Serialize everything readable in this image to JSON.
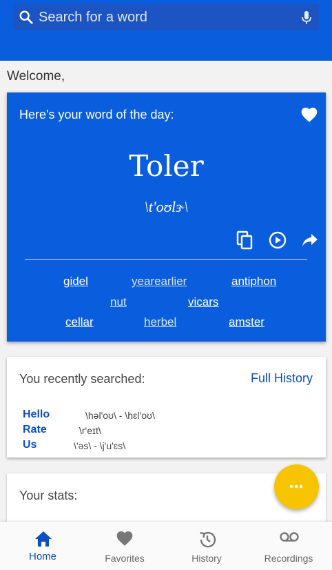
{
  "search": {
    "placeholder": "Search for a word"
  },
  "welcome": "Welcome,",
  "word_of_day": {
    "intro": "Here's your word of the day:",
    "word": "Toler",
    "pronunciation": "\\t'oʊlɝ\\",
    "related_words": [
      {
        "text": "gidel"
      },
      {
        "text": "yearearlier"
      },
      {
        "text": "antiphon"
      },
      {
        "text": "nut"
      },
      {
        "text": "vicars"
      },
      {
        "text": "cellar"
      },
      {
        "text": "herbel"
      },
      {
        "text": "amster"
      }
    ]
  },
  "recent": {
    "title": "You recently searched:",
    "full_history_label": "Full History",
    "items": [
      {
        "word": "Hello",
        "pron": "\\həl'oʊ\\ - \\hɛl'oʊ\\"
      },
      {
        "word": "Rate",
        "pron": "\\r'eɪt\\"
      },
      {
        "word": "Us",
        "pron": "\\'əs\\ - \\j'u'ɛs\\"
      }
    ]
  },
  "stats": {
    "title": "Your stats:"
  },
  "bottom_nav": {
    "items": [
      {
        "label": "Home",
        "icon": "home-icon",
        "active": true
      },
      {
        "label": "Favorites",
        "icon": "heart-icon",
        "active": false
      },
      {
        "label": "History",
        "icon": "history-icon",
        "active": false
      },
      {
        "label": "Recordings",
        "icon": "voicemail-icon",
        "active": false
      }
    ]
  },
  "colors": {
    "primary": "#0a5ddc",
    "accent_text": "#0d4fc2",
    "fab": "#f6c400",
    "background": "#f2f2f2"
  }
}
